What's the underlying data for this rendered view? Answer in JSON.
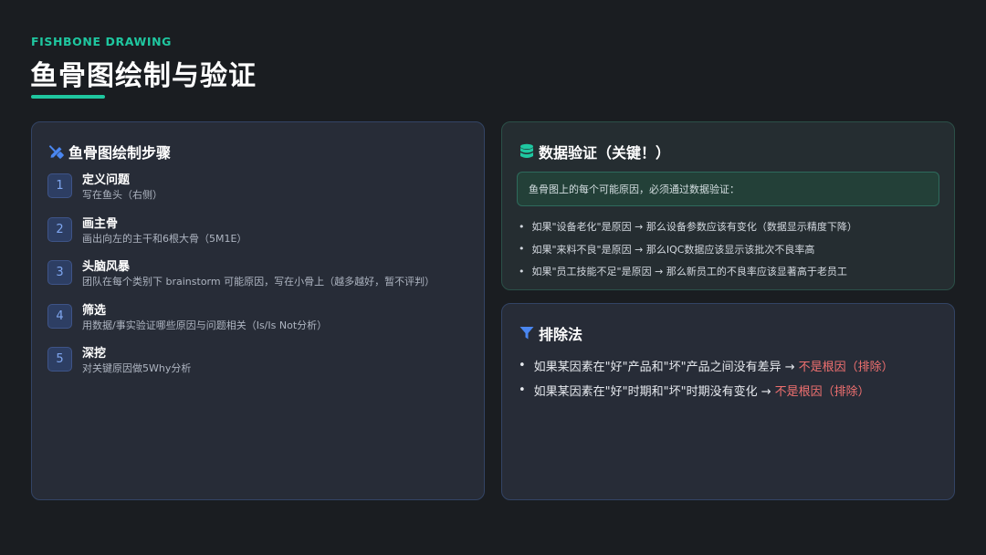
{
  "header": {
    "eyebrow": "FISHBONE DRAWING",
    "title": "鱼骨图绘制与验证"
  },
  "steps_card": {
    "title": "鱼骨图绘制步骤",
    "icon": "pencil-ruler-icon",
    "steps": [
      {
        "num": "1",
        "title": "定义问题",
        "desc": "写在鱼头（右侧）"
      },
      {
        "num": "2",
        "title": "画主骨",
        "desc": "画出向左的主干和6根大骨（5M1E）"
      },
      {
        "num": "3",
        "title": "头脑风暴",
        "desc": "团队在每个类别下 brainstorm 可能原因，写在小骨上（越多越好，暂不评判）"
      },
      {
        "num": "4",
        "title": "筛选",
        "desc": "用数据/事实验证哪些原因与问题相关（Is/Is Not分析）"
      },
      {
        "num": "5",
        "title": "深挖",
        "desc": "对关键原因做5Why分析"
      }
    ]
  },
  "data_card": {
    "title": "数据验证（关键！）",
    "icon": "database-icon",
    "callout": "鱼骨图上的每个可能原因，必须通过数据验证：",
    "bullets": [
      "如果\"设备老化\"是原因 → 那么设备参数应该有变化（数据显示精度下降）",
      "如果\"来料不良\"是原因 → 那么IQC数据应该显示该批次不良率高",
      "如果\"员工技能不足\"是原因 → 那么新员工的不良率应该显著高于老员工"
    ]
  },
  "exclusion_card": {
    "title": "排除法",
    "icon": "filter-icon",
    "items": [
      {
        "text": "如果某因素在\"好\"产品和\"坏\"产品之间没有差异 →",
        "result": "不是根因（排除）"
      },
      {
        "text": "如果某因素在\"好\"时期和\"坏\"时期没有变化 →",
        "result": "不是根因（排除）"
      }
    ]
  },
  "colors": {
    "accent_teal": "#1fc7a0",
    "accent_blue": "#4a86f0",
    "exclude_red": "#f07070",
    "background": "#1a1d21"
  }
}
